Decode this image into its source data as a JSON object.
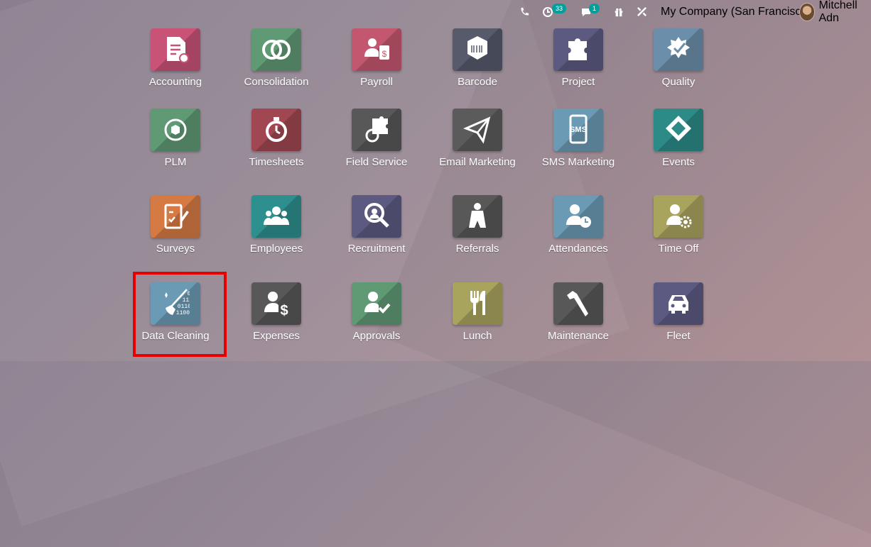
{
  "topbar": {
    "phone_icon": "phone-icon",
    "activity_icon": "clock-icon",
    "activity_count": "33",
    "messages_icon": "chat-icon",
    "messages_count": "1",
    "gift_icon": "gift-icon",
    "debug_icon": "tools-icon",
    "company": "My Company (San Francisco)",
    "user": "Mitchell Adn"
  },
  "colors": {
    "badge": "#00a09d",
    "highlight": "#e60000"
  },
  "apps": [
    {
      "label": "Accounting",
      "icon": "accounting-icon",
      "color": "#c85377"
    },
    {
      "label": "Consolidation",
      "icon": "consolidation-icon",
      "color": "#5f9a74"
    },
    {
      "label": "Payroll",
      "icon": "payroll-icon",
      "color": "#c45770"
    },
    {
      "label": "Barcode",
      "icon": "barcode-icon",
      "color": "#565a6b"
    },
    {
      "label": "Project",
      "icon": "project-icon",
      "color": "#5d5a82"
    },
    {
      "label": "Quality",
      "icon": "quality-icon",
      "color": "#6b8faa"
    },
    {
      "label": "PLM",
      "icon": "plm-icon",
      "color": "#5f9a74"
    },
    {
      "label": "Timesheets",
      "icon": "timesheets-icon",
      "color": "#a14752"
    },
    {
      "label": "Field Service",
      "icon": "field-service-icon",
      "color": "#585858"
    },
    {
      "label": "Email Marketing",
      "icon": "email-marketing-icon",
      "color": "#5b5b5b"
    },
    {
      "label": "SMS Marketing",
      "icon": "sms-marketing-icon",
      "color": "#6b9ab4"
    },
    {
      "label": "Events",
      "icon": "events-icon",
      "color": "#2c8b87"
    },
    {
      "label": "Surveys",
      "icon": "surveys-icon",
      "color": "#d67a43"
    },
    {
      "label": "Employees",
      "icon": "employees-icon",
      "color": "#2d8f8e"
    },
    {
      "label": "Recruitment",
      "icon": "recruitment-icon",
      "color": "#5d5a82"
    },
    {
      "label": "Referrals",
      "icon": "referrals-icon",
      "color": "#585858"
    },
    {
      "label": "Attendances",
      "icon": "attendances-icon",
      "color": "#6b9ab4"
    },
    {
      "label": "Time Off",
      "icon": "time-off-icon",
      "color": "#a8a45e"
    },
    {
      "label": "Data Cleaning",
      "icon": "data-cleaning-icon",
      "color": "#6b9ab4",
      "binary": [
        "00",
        "111",
        "0110",
        "1100"
      ]
    },
    {
      "label": "Expenses",
      "icon": "expenses-icon",
      "color": "#585858"
    },
    {
      "label": "Approvals",
      "icon": "approvals-icon",
      "color": "#5f9a74"
    },
    {
      "label": "Lunch",
      "icon": "lunch-icon",
      "color": "#a8a45e"
    },
    {
      "label": "Maintenance",
      "icon": "maintenance-icon",
      "color": "#585858"
    },
    {
      "label": "Fleet",
      "icon": "fleet-icon",
      "color": "#5d5a82"
    }
  ]
}
